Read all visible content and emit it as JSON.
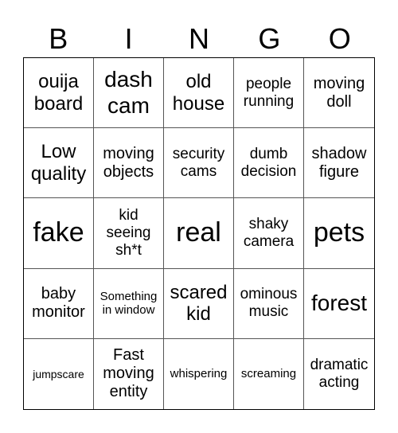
{
  "header": {
    "letters": [
      "B",
      "I",
      "N",
      "G",
      "O"
    ]
  },
  "board": {
    "rows": [
      [
        "ouija\nboard",
        "dash\ncam",
        "old\nhouse",
        "people\nrunning",
        "moving\ndoll"
      ],
      [
        "Low\nquality",
        "moving\nobjects",
        "security\ncams",
        "dumb\ndecision",
        "shadow\nfigure"
      ],
      [
        "fake",
        "kid\nseeing\nsh*t",
        "real",
        "shaky\ncamera",
        "pets"
      ],
      [
        "baby\nmonitor",
        "Something\nin window",
        "scared\nkid",
        "ominous\nmusic",
        "forest"
      ],
      [
        "jumpscare",
        "Fast\nmoving\nentity",
        "whispering",
        "screaming",
        "dramatic\nacting"
      ]
    ]
  }
}
